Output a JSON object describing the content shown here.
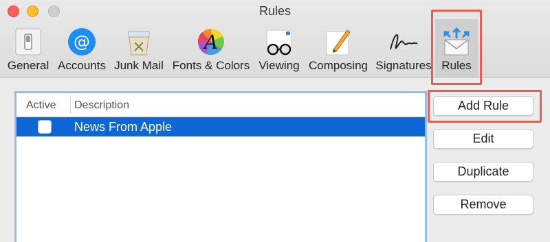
{
  "window": {
    "title": "Rules"
  },
  "toolbar": {
    "items": [
      {
        "label": "General",
        "icon": "general-switch-icon"
      },
      {
        "label": "Accounts",
        "icon": "at-sign-icon"
      },
      {
        "label": "Junk Mail",
        "icon": "junk-bin-icon"
      },
      {
        "label": "Fonts & Colors",
        "icon": "font-color-wheel-icon"
      },
      {
        "label": "Viewing",
        "icon": "glasses-icon"
      },
      {
        "label": "Composing",
        "icon": "pencil-paper-icon"
      },
      {
        "label": "Signatures",
        "icon": "signature-icon"
      },
      {
        "label": "Rules",
        "icon": "envelope-arrows-icon",
        "selected": true
      }
    ]
  },
  "rules_list": {
    "columns": {
      "active": "Active",
      "description": "Description"
    },
    "rows": [
      {
        "active": false,
        "description": "News From Apple",
        "selected": true
      }
    ]
  },
  "buttons": {
    "add_rule": "Add Rule",
    "edit": "Edit",
    "duplicate": "Duplicate",
    "remove": "Remove"
  },
  "colors": {
    "selection": "#0f66d6",
    "highlight": "#e0605a",
    "focus_ring": "#93bdf0"
  }
}
